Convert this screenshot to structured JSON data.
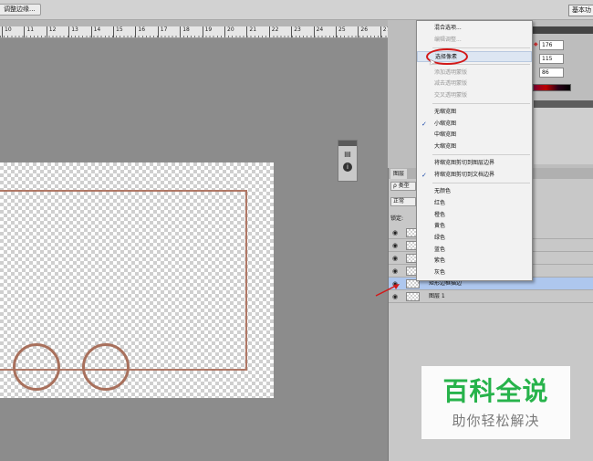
{
  "optionsbar": {
    "left_button_label": "调整边缘...",
    "workspace_button_label": "基本功"
  },
  "ruler": {
    "ticks": [
      "10",
      "11",
      "12",
      "13",
      "14",
      "15",
      "16",
      "17",
      "18",
      "19",
      "20",
      "21",
      "22",
      "23",
      "24",
      "25",
      "26",
      "27",
      "28"
    ]
  },
  "color_panel": {
    "fields": [
      "176",
      "115",
      "86"
    ]
  },
  "menu": {
    "items": [
      {
        "label": "混合选项...",
        "disabled": false,
        "checked": false,
        "highlighted": false
      },
      {
        "label": "编辑调整...",
        "disabled": true,
        "checked": false,
        "highlighted": false
      },
      {
        "label": "选择像素",
        "disabled": false,
        "checked": false,
        "highlighted": true
      },
      {
        "label": "添加透明蒙版",
        "disabled": true,
        "checked": false,
        "highlighted": false
      },
      {
        "label": "减去透明蒙版",
        "disabled": true,
        "checked": false,
        "highlighted": false
      },
      {
        "label": "交叉透明蒙版",
        "disabled": true,
        "checked": false,
        "highlighted": false
      },
      {
        "label": "无缩览图",
        "disabled": false,
        "checked": false,
        "highlighted": false
      },
      {
        "label": "小缩览图",
        "disabled": false,
        "checked": true,
        "highlighted": false
      },
      {
        "label": "中缩览图",
        "disabled": false,
        "checked": false,
        "highlighted": false
      },
      {
        "label": "大缩览图",
        "disabled": false,
        "checked": false,
        "highlighted": false
      },
      {
        "label": "将缩览图剪切到图层边界",
        "disabled": false,
        "checked": false,
        "highlighted": false
      },
      {
        "label": "将缩览图剪切到文档边界",
        "disabled": false,
        "checked": true,
        "highlighted": false
      },
      {
        "label": "无颜色",
        "disabled": false,
        "checked": false,
        "highlighted": false
      },
      {
        "label": "红色",
        "disabled": false,
        "checked": false,
        "highlighted": false
      },
      {
        "label": "橙色",
        "disabled": false,
        "checked": false,
        "highlighted": false
      },
      {
        "label": "黄色",
        "disabled": false,
        "checked": false,
        "highlighted": false
      },
      {
        "label": "绿色",
        "disabled": false,
        "checked": false,
        "highlighted": false
      },
      {
        "label": "蓝色",
        "disabled": false,
        "checked": false,
        "highlighted": false
      },
      {
        "label": "紫色",
        "disabled": false,
        "checked": false,
        "highlighted": false
      },
      {
        "label": "灰色",
        "disabled": false,
        "checked": false,
        "highlighted": false
      }
    ]
  },
  "layers_panel": {
    "tab_label": "图层",
    "search_label": "ρ 类型",
    "mode_label": "正常",
    "lock_label": "锁定:",
    "layers": [
      {
        "name": "",
        "selected": false
      },
      {
        "name": "",
        "selected": false
      },
      {
        "name": "",
        "selected": false
      },
      {
        "name": "",
        "selected": false
      },
      {
        "name": "矩形边框描边",
        "selected": true
      },
      {
        "name": "图层 1",
        "selected": false
      }
    ]
  },
  "watermark": {
    "title": "百科全说",
    "subtitle": "助你轻松解决"
  },
  "colors": {
    "accent_red": "#d31818",
    "selection": "#aec7ee",
    "ring": "#a8705c",
    "watermark_green": "#27b34b"
  }
}
